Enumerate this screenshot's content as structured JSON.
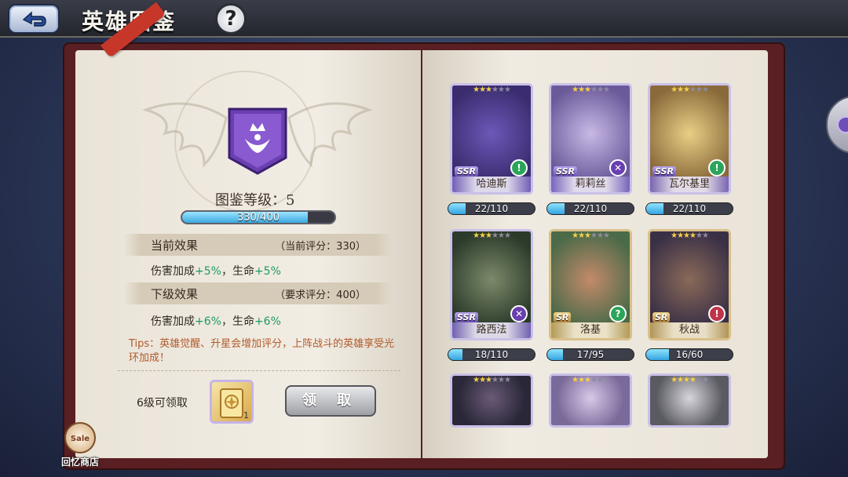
{
  "header": {
    "title": "英雄图鉴",
    "help_label": "?"
  },
  "codex": {
    "level_text": "图鉴等级：5",
    "progress": {
      "current": 330,
      "max": 400,
      "text": "330/400"
    },
    "current_effect": {
      "title": "当前效果",
      "note": "（当前评分：330）",
      "damage_label": "伤害加成",
      "damage_value": "+5%",
      "separator": "，",
      "hp_label": "生命",
      "hp_value": "+5%"
    },
    "next_effect": {
      "title": "下级效果",
      "note": "（要求评分：400）",
      "damage_label": "伤害加成",
      "damage_value": "+6%",
      "separator": "，",
      "hp_label": "生命",
      "hp_value": "+6%"
    },
    "tips": "Tips：英雄觉醒、升星会增加评分，上阵战斗的英雄享受光环加成！",
    "unlock_text": "6级可领取",
    "reward_count": "1",
    "claim_label": "领 取"
  },
  "shop": {
    "sale_label": "Sale",
    "label": "回忆商店"
  },
  "colors": {
    "accent_green": "#1c9a62",
    "progress_blue": "#3aa9e0",
    "tips_orange": "#b25a2a"
  },
  "heroes": [
    {
      "name": "哈迪斯",
      "rank": "SSR",
      "stars": 3,
      "class_icon": "sword-class-icon",
      "fragments": "22/110",
      "frag_ratio": 0.2
    },
    {
      "name": "莉莉丝",
      "rank": "SSR",
      "stars": 3,
      "class_icon": "assassin-class-icon",
      "fragments": "22/110",
      "frag_ratio": 0.2
    },
    {
      "name": "瓦尔基里",
      "rank": "SSR",
      "stars": 3,
      "class_icon": "sword-class-icon",
      "fragments": "22/110",
      "frag_ratio": 0.2
    },
    {
      "name": "路西法",
      "rank": "SSR",
      "stars": 3,
      "class_icon": "assassin-class-icon",
      "fragments": "18/110",
      "frag_ratio": 0.164
    },
    {
      "name": "洛基",
      "rank": "SR",
      "stars": 3,
      "class_icon": "support-class-icon",
      "fragments": "17/95",
      "frag_ratio": 0.179
    },
    {
      "name": "秋战",
      "rank": "SR",
      "stars": 4,
      "class_icon": "warrior-class-icon",
      "fragments": "16/60",
      "frag_ratio": 0.267
    },
    {
      "name": "",
      "rank": "",
      "stars": 3,
      "class_icon": "",
      "fragments": "",
      "frag_ratio": 0
    },
    {
      "name": "",
      "rank": "",
      "stars": 3,
      "class_icon": "",
      "fragments": "",
      "frag_ratio": 0
    },
    {
      "name": "",
      "rank": "",
      "stars": 4,
      "class_icon": "",
      "fragments": "",
      "frag_ratio": 0
    }
  ]
}
